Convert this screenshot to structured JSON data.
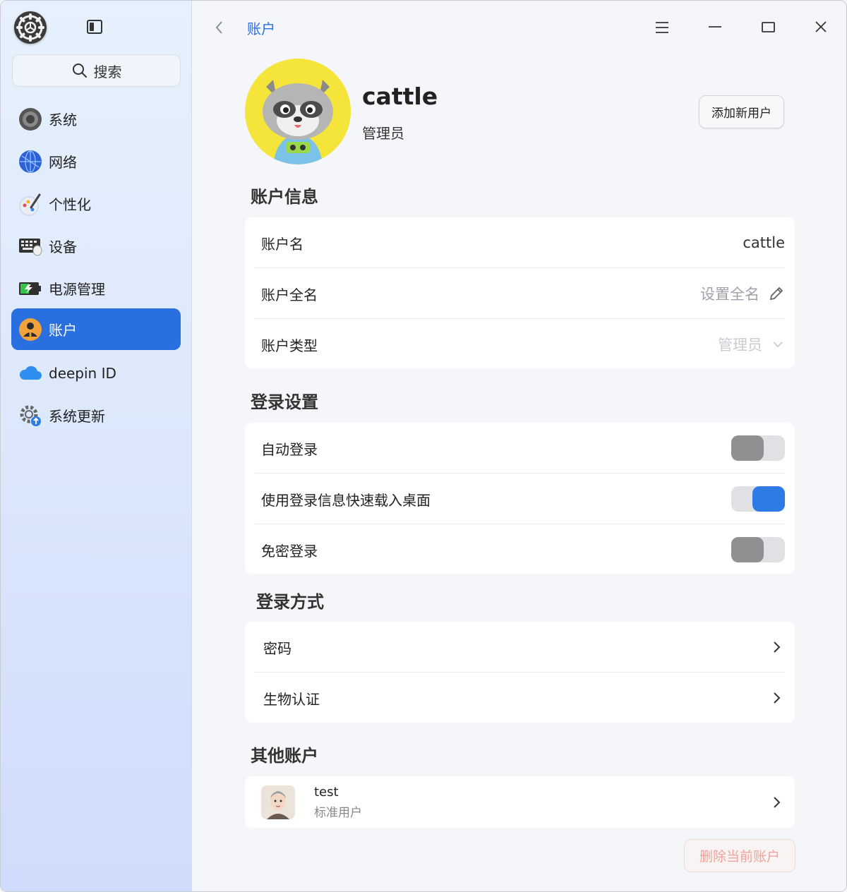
{
  "sidebar": {
    "search_label": "搜索",
    "items": [
      {
        "label": "系统",
        "icon": "system-icon"
      },
      {
        "label": "网络",
        "icon": "network-icon"
      },
      {
        "label": "个性化",
        "icon": "personalization-icon"
      },
      {
        "label": "设备",
        "icon": "device-icon"
      },
      {
        "label": "电源管理",
        "icon": "power-icon"
      },
      {
        "label": "账户",
        "icon": "account-icon",
        "active": true
      },
      {
        "label": "deepin ID",
        "icon": "cloud-icon"
      },
      {
        "label": "系统更新",
        "icon": "update-icon"
      }
    ]
  },
  "header": {
    "title": "账户"
  },
  "profile": {
    "name": "cattle",
    "role": "管理员",
    "add_user_label": "添加新用户"
  },
  "account_info": {
    "title": "账户信息",
    "rows": [
      {
        "label": "账户名",
        "value": "cattle"
      },
      {
        "label": "账户全名",
        "value": "设置全名"
      },
      {
        "label": "账户类型",
        "value": "管理员"
      }
    ]
  },
  "login_settings": {
    "title": "登录设置",
    "rows": [
      {
        "label": "自动登录",
        "enabled": false
      },
      {
        "label": "使用登录信息快速载入桌面",
        "enabled": true
      },
      {
        "label": "免密登录",
        "enabled": false
      }
    ]
  },
  "login_methods": {
    "title": "登录方式",
    "rows": [
      {
        "label": "密码"
      },
      {
        "label": "生物认证"
      }
    ]
  },
  "other_accounts": {
    "title": "其他账户",
    "users": [
      {
        "name": "test",
        "type": "标准用户"
      }
    ]
  },
  "delete_label": "删除当前账户",
  "colors": {
    "accent": "#2a6fe0",
    "toggle_on": "#2f7be6",
    "toggle_off": "#8f9091",
    "danger_text": "#f0a39a"
  }
}
